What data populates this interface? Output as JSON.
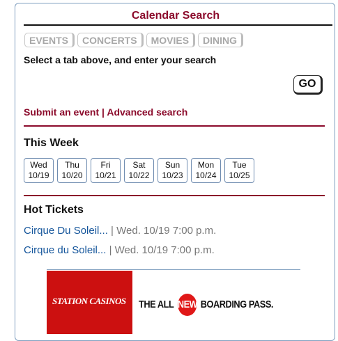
{
  "calendar": {
    "title": "Calendar Search",
    "tabs": [
      {
        "label": "EVENTS"
      },
      {
        "label": "CONCERTS"
      },
      {
        "label": "MOVIES"
      },
      {
        "label": "DINING"
      }
    ],
    "hint": "Select a tab above, and enter your search",
    "go_label": "GO",
    "submit_link": "Submit an event",
    "separator": "|",
    "advanced_link": "Advanced search"
  },
  "week": {
    "title": "This Week",
    "days": [
      {
        "name": "Wed",
        "date": "10/19"
      },
      {
        "name": "Thu",
        "date": "10/20"
      },
      {
        "name": "Fri",
        "date": "10/21"
      },
      {
        "name": "Sat",
        "date": "10/22"
      },
      {
        "name": "Sun",
        "date": "10/23"
      },
      {
        "name": "Mon",
        "date": "10/24"
      },
      {
        "name": "Tue",
        "date": "10/25"
      }
    ]
  },
  "tickets": {
    "title": "Hot Tickets",
    "items": [
      {
        "name": "Cirque Du Soleil...",
        "info": " | Wed. 10/19 7:00 p.m."
      },
      {
        "name": "Cirque du Soleil...",
        "info": " | Wed. 10/19 7:00 p.m."
      }
    ]
  },
  "ad": {
    "logo_text": "STATION CASINOS",
    "text_before": "THE ALL",
    "badge": "NEW",
    "text_after": "BOARDING PASS."
  },
  "colors": {
    "accent": "#8b0a2b",
    "link": "#14559b",
    "border": "#7f9fbf",
    "ad_red": "#cc1010"
  }
}
